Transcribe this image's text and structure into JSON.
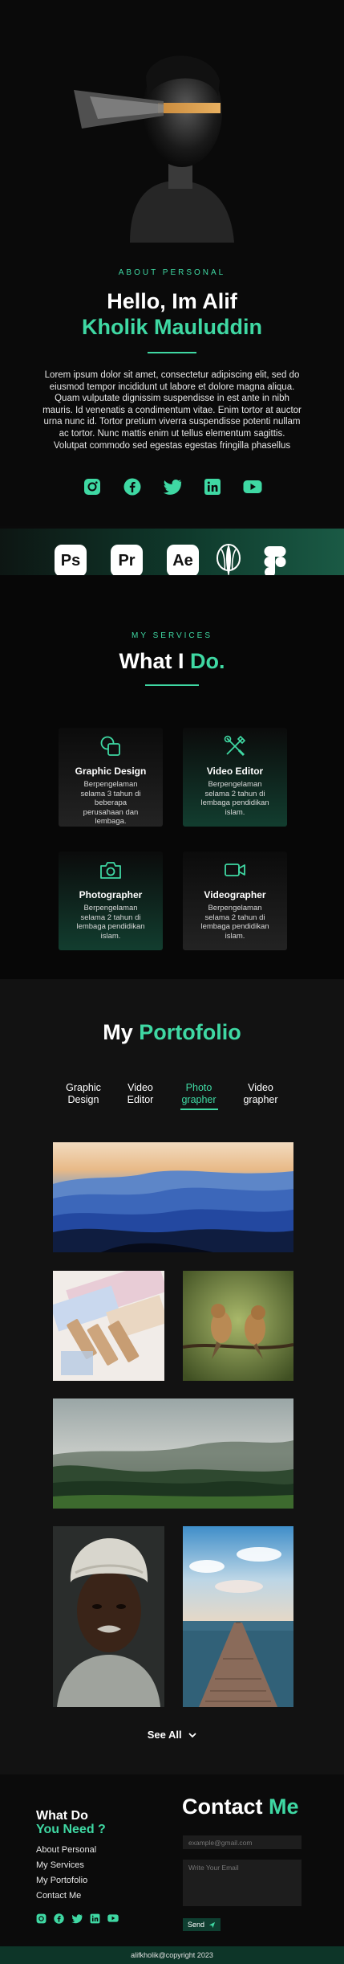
{
  "hero": {
    "eyebrow": "ABOUT PERSONAL",
    "greeting": "Hello, Im Alif",
    "name": "Kholik Mauluddin",
    "bio": "Lorem ipsum dolor sit amet, consectetur adipiscing elit, sed do eiusmod tempor incididunt ut labore et dolore magna aliqua. Quam vulputate dignissim suspendisse in est ante in nibh mauris. Id venenatis a condimentum vitae. Enim tortor at auctor urna nunc id. Tortor pretium viverra suspendisse potenti nullam ac tortor. Nunc mattis enim ut tellus elementum sagittis. Volutpat commodo sed egestas egestas fringilla phasellus",
    "social_icons": [
      "instagram-icon",
      "facebook-icon",
      "twitter-icon",
      "linkedin-icon",
      "youtube-icon"
    ]
  },
  "tools": [
    {
      "label": "Ps",
      "icon": "photoshop-icon"
    },
    {
      "label": "Pr",
      "icon": "premiere-pro-icon"
    },
    {
      "label": "Ae",
      "icon": "after-effects-icon"
    },
    {
      "label": "",
      "icon": "inkscape-icon"
    },
    {
      "label": "",
      "icon": "figma-icon"
    }
  ],
  "services": {
    "eyebrow": "MY SERVICES",
    "title_main": "What I ",
    "title_accent": "Do.",
    "cards": [
      {
        "title": "Graphic Design",
        "desc": "Berpengelaman selama 3 tahun di beberapa perusahaan dan lembaga.",
        "icon": "shapes-icon"
      },
      {
        "title": "Video Editor",
        "desc": "Berpengelaman selama 2 tahun di lembaga pendidikan islam.",
        "icon": "tools-icon"
      },
      {
        "title": "Photographer",
        "desc": "Berpengelaman selama 2 tahun di lembaga pendidikan islam.",
        "icon": "camera-icon"
      },
      {
        "title": "Videographer",
        "desc": "Berpengelaman selama 2 tahun di lembaga pendidikan islam.",
        "icon": "video-camera-icon"
      }
    ]
  },
  "portfolio": {
    "title_main": "My ",
    "title_accent": "Portofolio",
    "tabs": [
      {
        "label": "Graphic Design",
        "active": false
      },
      {
        "label": "Video Editor",
        "active": false
      },
      {
        "label": "Photo grapher",
        "active": true
      },
      {
        "label": "Video grapher",
        "active": false
      }
    ],
    "see_all": "See All"
  },
  "footer": {
    "what_do": "What Do",
    "you_need": "You Need ?",
    "links": [
      "About Personal",
      "My Services",
      "My Portofolio",
      "Contact Me"
    ],
    "contact_main": "Contact ",
    "contact_accent": "Me",
    "email_placeholder": "example@gmail.com",
    "message_placeholder": "Write Your Email",
    "send_label": "Send",
    "copyright": "alifkholik@copyright 2023"
  },
  "colors": {
    "accent": "#3fd8a3",
    "background": "#0b0b0b",
    "band_green": "#0f3a2c"
  }
}
